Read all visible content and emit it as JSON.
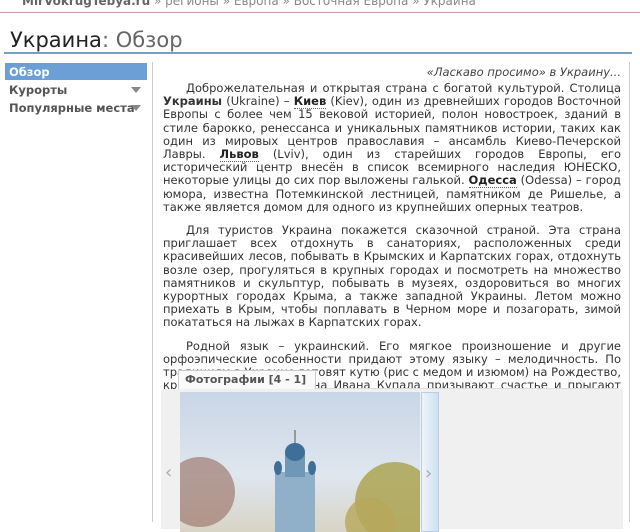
{
  "breadcrumb": {
    "site": "MirVokrugTebya.ru",
    "items": [
      "регионы",
      "Европа",
      "Восточная Европа",
      "Украина"
    ],
    "sep": "»"
  },
  "header": {
    "title": "Украина",
    "subtitle": "Обзор",
    "colon": ":"
  },
  "sidebar": {
    "items": [
      {
        "label": "Обзор"
      },
      {
        "label": "Курорты"
      },
      {
        "label": "Популярные места"
      }
    ]
  },
  "content": {
    "quote": "«Ласкаво просимо» в Украину...",
    "p1": {
      "a": "Доброжелательная и открытая страна с богатой культурой. Столица ",
      "b": "Украины",
      "c": " (Ukraine) – ",
      "kiev": "Киев",
      "d": " (Kiev), один из древнейших городов Восточной Европы с более чем 15 вековой историей, полон новостроек, зданий в стиле барокко, ренессанса и уникальных памятников истории, таких как один из мировых центров православия – ансамбль Киево-Печерской Лавры. ",
      "lviv": "Львов",
      "e": " (Lviv), один из старейших городов Европы, его исторический центр внесён в список всемирного наследия ЮНЕСКО, некоторые улицы до сих пор выложены галькой. ",
      "odessa": "Одесса",
      "f": " (Odessa) – город юмора, известна Потемкинской лестницей, памятником де Ришелье, а также является домом для одного из крупнейших оперных театров."
    },
    "p2": "Для туристов Украина покажется сказочной страной. Эта страна приглашает всех отдохнуть в санаториях, расположенных среди красивейших лесов, побывать в Крымских и Карпатских горах, отдохнуть возле озер, прогуляться в крупных городах и посмотреть на множество памятников и скульптур, побывать в музеях, оздоровиться во многих курортных городах Крыма, а также западной Украины. Летом можно приехать в Крым, чтобы поплавать в Черном море и позагорать, зимой покататься на лыжах в Карпатских горах.",
    "p3": "Родной язык – украинский. Его мягкое произношение и другие орфоэпические особенности придают этому языку – мелодичность. По традициям в Украине готовят кутю (рис с медом и изюмом) на Рождество, красит яйца на Паску, на Ивана Купала призывают счастье и прыгают через огонь, в день Екатерины просят хорошей судьбы."
  },
  "gallery": {
    "tab_label": "Фотографии [4 - 1]",
    "prev": "‹",
    "next": "›"
  }
}
